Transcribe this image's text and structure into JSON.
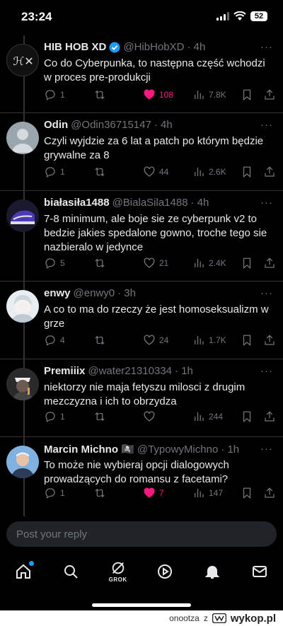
{
  "status_bar": {
    "time": "23:24",
    "battery": "52"
  },
  "tweets": [
    {
      "author": "HIB HOB XD",
      "handle": "@HibHobXD",
      "time": "· 4h",
      "verified": true,
      "text": "Co do Cyberpunka, to następna część wchodzi w proces pre-produkcji",
      "replies": "1",
      "retweets": "",
      "likes": "108",
      "liked": true,
      "views": "7.8K"
    },
    {
      "author": "Odin",
      "handle": "@Odin36715147",
      "time": "· 4h",
      "text": "Czyli wyjdzie za 6 lat a patch po którym będzie grywalne za 8",
      "replies": "1",
      "retweets": "",
      "likes": "44",
      "liked": false,
      "views": "2.6K"
    },
    {
      "author": "białasiła1488",
      "handle": "@BialaSila1488",
      "time": "· 4h",
      "text": "7-8 minimum, ale boje sie ze cyberpunk v2 to bedzie jakies spedalone gowno, troche tego sie nazbieralo w jedynce",
      "replies": "5",
      "retweets": "",
      "likes": "21",
      "liked": false,
      "views": "2.4K"
    },
    {
      "author": "enwy",
      "handle": "@enwy0",
      "time": "· 3h",
      "text": "A co to ma do rzeczy że jest homoseksualizm w grze",
      "replies": "4",
      "retweets": "",
      "likes": "24",
      "liked": false,
      "views": "1.7K"
    },
    {
      "author": "Premiiix",
      "handle": "@water21310334",
      "time": "· 1h",
      "text": "niektorzy nie maja fetyszu milosci z drugim mezczyzna i ich to obrzydza",
      "replies": "1",
      "retweets": "",
      "likes": "",
      "liked": false,
      "views": "244"
    },
    {
      "author": "Marcin Michno 🏴‍☠️",
      "handle": "@TypowyMichno",
      "time": "· 1h",
      "text": "To może nie wybieraj opcji dialogowych prowadzących do romansu z facetami?",
      "replies": "1",
      "retweets": "",
      "likes": "7",
      "liked": true,
      "views": "147"
    }
  ],
  "reply_box": {
    "placeholder": "Post your reply"
  },
  "tabbar": {
    "grok_label": "GROK"
  },
  "footer": {
    "user": "onootza",
    "sep": "z",
    "site": "wykop.pl"
  },
  "colors": {
    "background": "#000000",
    "text": "#e7e9ea",
    "muted": "#71767b",
    "like": "#f91880",
    "accent": "#1d9bf0"
  },
  "icons": [
    "reply-icon",
    "retweet-icon",
    "like-icon",
    "views-icon",
    "bookmark-icon",
    "share-icon",
    "home-icon",
    "search-icon",
    "grok-icon",
    "video-icon",
    "notifications-icon",
    "messages-icon"
  ]
}
